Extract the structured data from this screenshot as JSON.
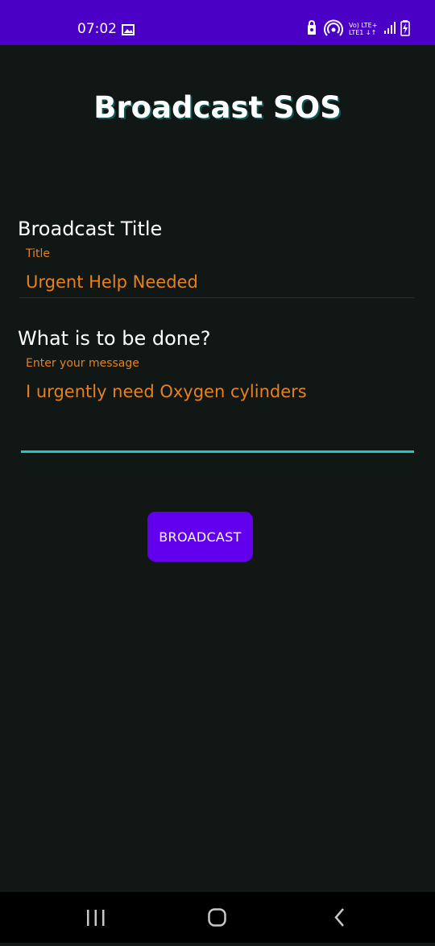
{
  "status_bar": {
    "time": "07:02",
    "network_line1": "Vo) LTE+",
    "network_line2": "LTE1 ↓↑",
    "icons": [
      "image-icon",
      "lock-icon",
      "hotspot-icon",
      "signal-icon",
      "battery-icon"
    ]
  },
  "header": {
    "title": "Broadcast SOS"
  },
  "form": {
    "title_section": {
      "heading": "Broadcast Title",
      "label": "Title",
      "value": "Urgent Help Needed"
    },
    "message_section": {
      "heading": "What is to be done?",
      "label": "Enter your message",
      "value": "I urgently  need Oxygen cylinders"
    },
    "button_label": "BROADCAST"
  },
  "nav_bar": {
    "icons": [
      "recent-apps-icon",
      "home-icon",
      "back-icon"
    ]
  },
  "colors": {
    "status_bar": "#4b00c5",
    "background": "#111714",
    "accent_orange": "#e5811f",
    "button": "#6200ee",
    "focus_underline": "#1fc7c0"
  }
}
